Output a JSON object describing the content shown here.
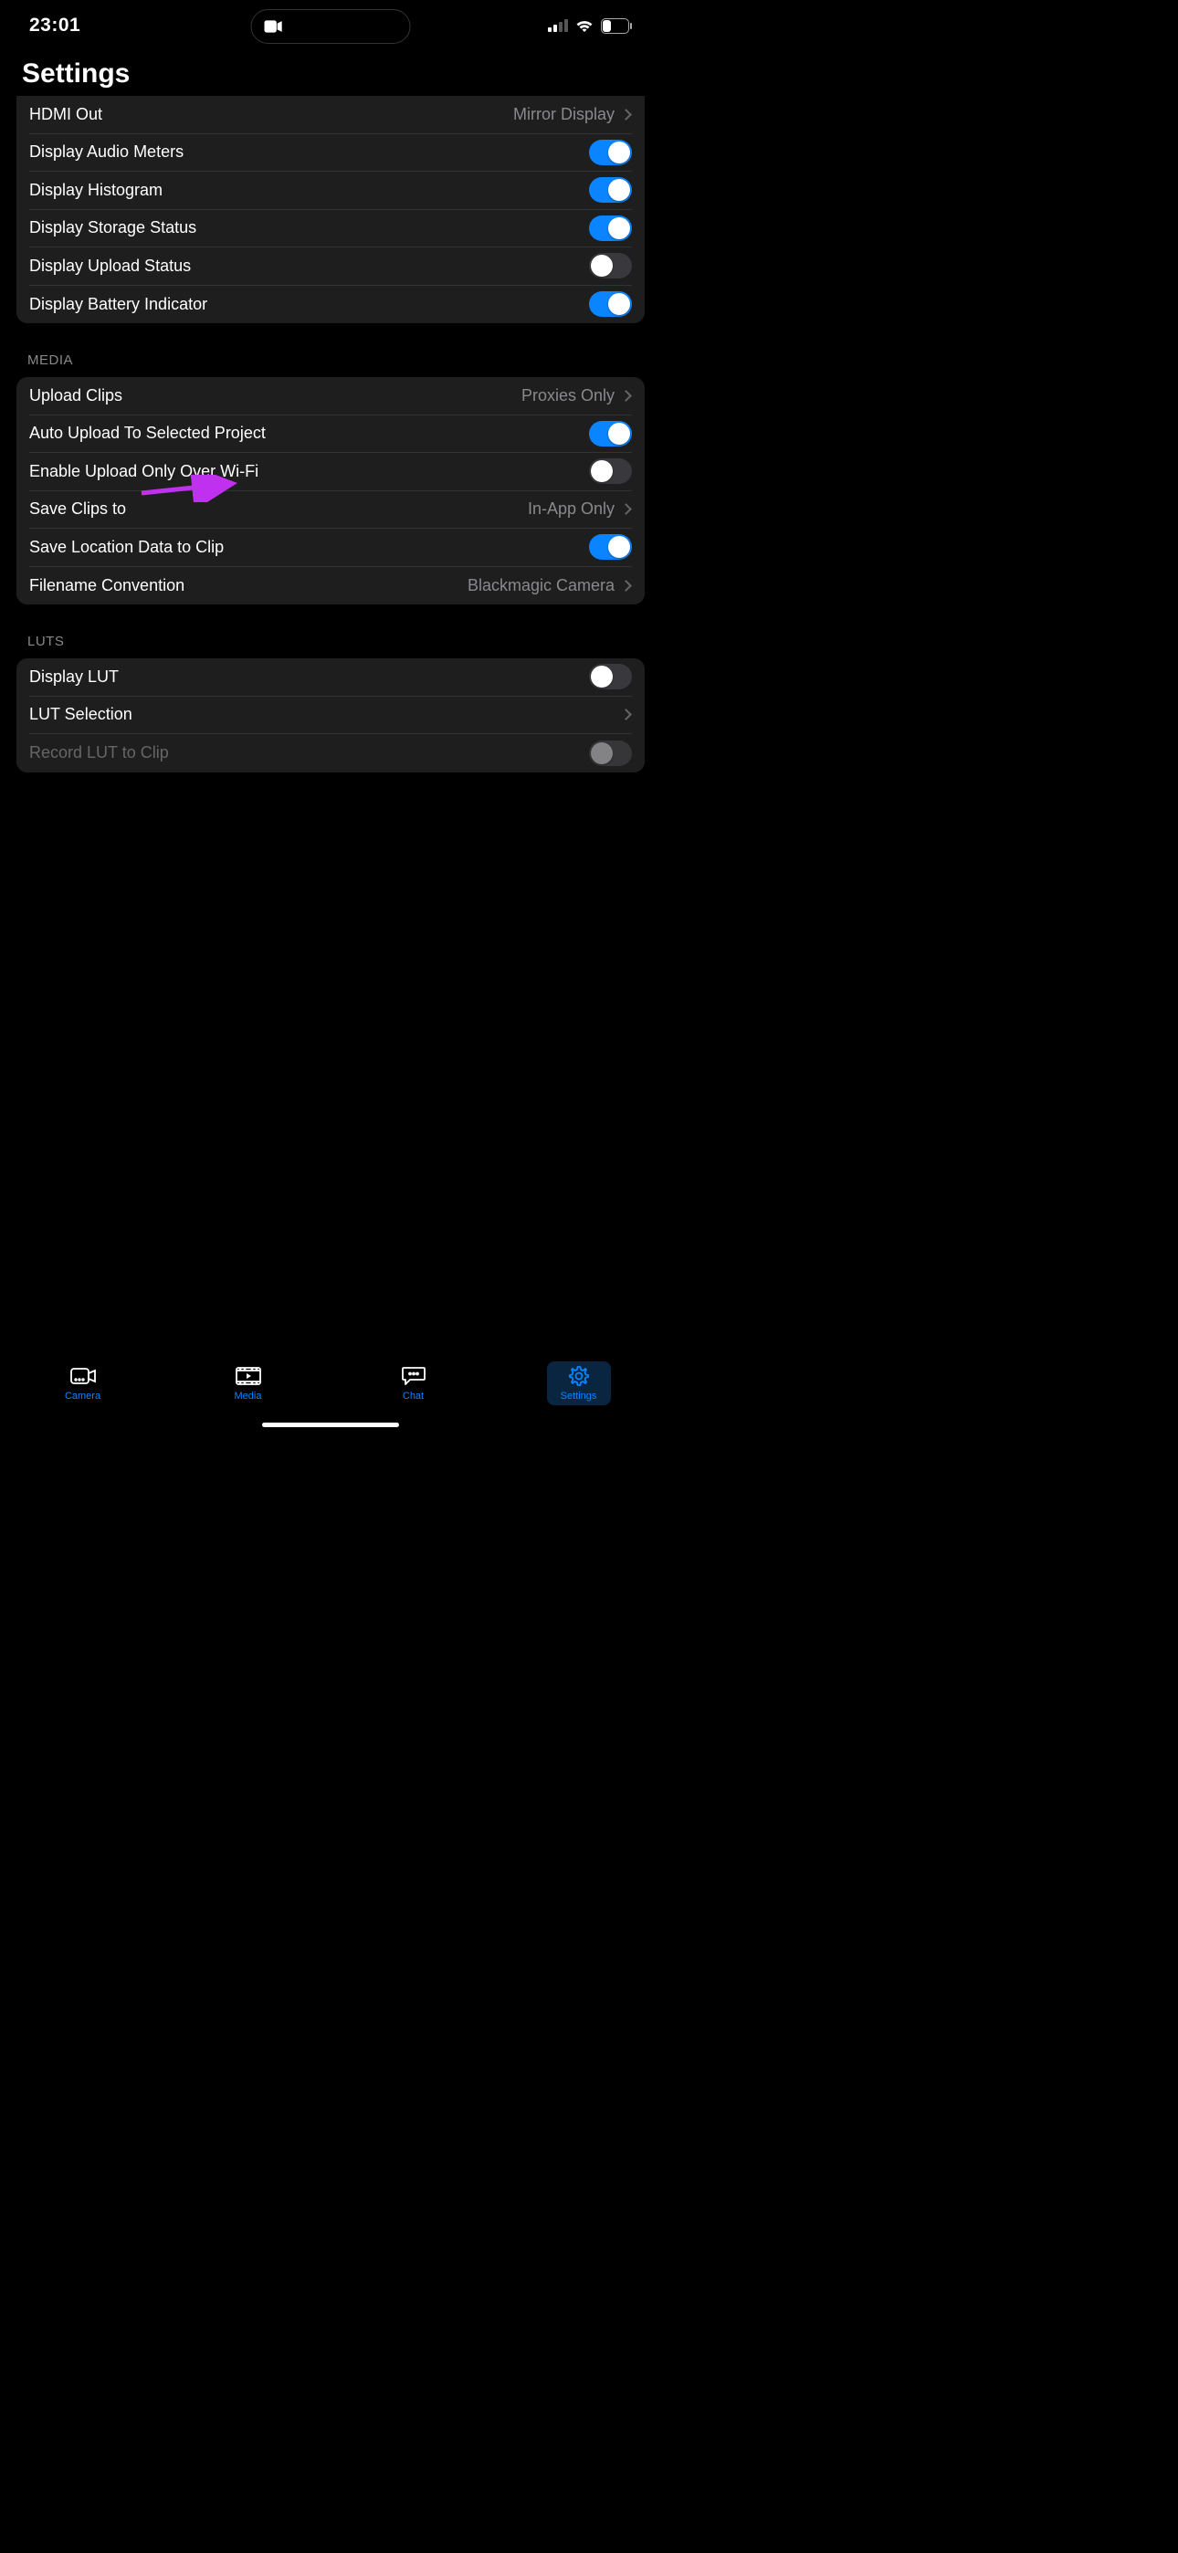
{
  "status": {
    "time": "23:01",
    "battery_pct": "26"
  },
  "page_title": "Settings",
  "sections": {
    "display": {
      "hdmi_out": {
        "label": "HDMI Out",
        "value": "Mirror Display"
      },
      "audio_meters": {
        "label": "Display Audio Meters",
        "on": true
      },
      "histogram": {
        "label": "Display Histogram",
        "on": true
      },
      "storage_status": {
        "label": "Display Storage Status",
        "on": true
      },
      "upload_status": {
        "label": "Display Upload Status",
        "on": false
      },
      "battery_indicator": {
        "label": "Display Battery Indicator",
        "on": true
      }
    },
    "media": {
      "header": "MEDIA",
      "upload_clips": {
        "label": "Upload Clips",
        "value": "Proxies Only"
      },
      "auto_upload": {
        "label": "Auto Upload To Selected Project",
        "on": true
      },
      "wifi_only": {
        "label": "Enable Upload Only Over Wi-Fi",
        "on": false
      },
      "save_clips": {
        "label": "Save Clips to",
        "value": "In-App Only"
      },
      "save_location": {
        "label": "Save Location Data to Clip",
        "on": true
      },
      "filename": {
        "label": "Filename Convention",
        "value": "Blackmagic Camera"
      }
    },
    "luts": {
      "header": "LUTS",
      "display_lut": {
        "label": "Display LUT",
        "on": false
      },
      "lut_selection": {
        "label": "LUT Selection"
      },
      "record_lut": {
        "label": "Record LUT to Clip",
        "disabled": true
      }
    }
  },
  "tabs": {
    "camera": "Camera",
    "media": "Media",
    "chat": "Chat",
    "settings": "Settings"
  },
  "annotation": {
    "color": "#c030ef"
  }
}
